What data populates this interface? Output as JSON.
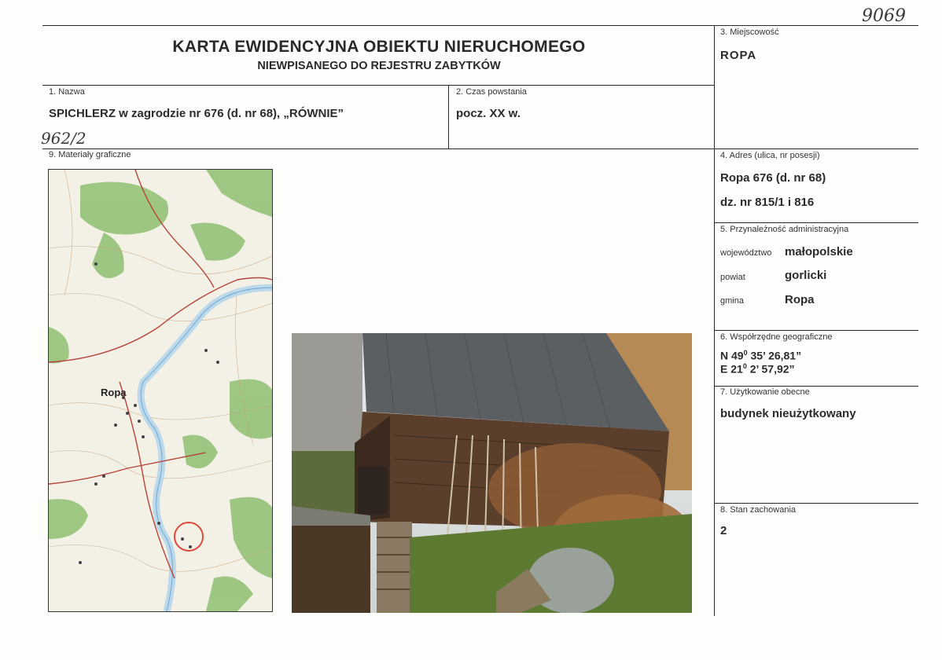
{
  "stamp_number": "9069",
  "header": {
    "title": "KARTA EWIDENCYJNA OBIEKTU NIERUCHOMEGO",
    "subtitle": "NIEWPISANEGO DO REJESTRU ZABYTKÓW"
  },
  "fields": {
    "name": {
      "label": "1. Nazwa",
      "value": "SPICHLERZ w zagrodzie nr 676 (d. nr 68), „RÓWNIE”"
    },
    "period": {
      "label": "2. Czas powstania",
      "value": "pocz. XX w."
    },
    "locality": {
      "label": "3. Miejscowość",
      "value": "ROPA"
    },
    "address": {
      "label": "4. Adres (ulica, nr posesji)",
      "line1": "Ropa 676 (d. nr 68)",
      "line2": "dz. nr 815/1 i 816"
    },
    "admin": {
      "label": "5. Przynależność administracyjna",
      "voivodeship_label": "województwo",
      "voivodeship": "małopolskie",
      "county_label": "powiat",
      "county": "gorlicki",
      "commune_label": "gmina",
      "commune": "Ropa"
    },
    "coords": {
      "label": "6. Współrzędne geograficzne",
      "n_prefix": "N 49",
      "n_deg": "0",
      "n_rest": " 35’ 26,81”",
      "e_prefix": "E 21",
      "e_deg": "0",
      "e_rest": " 2’ 57,92”"
    },
    "usage": {
      "label": "7. Użytkowanie obecne",
      "value": "budynek nieużytkowany"
    },
    "condition": {
      "label": "8. Stan zachowania",
      "value": "2"
    },
    "graphics": {
      "label": "9. Materiały graficzne",
      "handwritten_ref": "962/2"
    }
  },
  "map": {
    "town_label": "Ropa"
  },
  "colors": {
    "ink": "#2a2a2a",
    "map_green": "#7fb069",
    "river": "#cfe3f0",
    "marker": "#e0473c"
  }
}
